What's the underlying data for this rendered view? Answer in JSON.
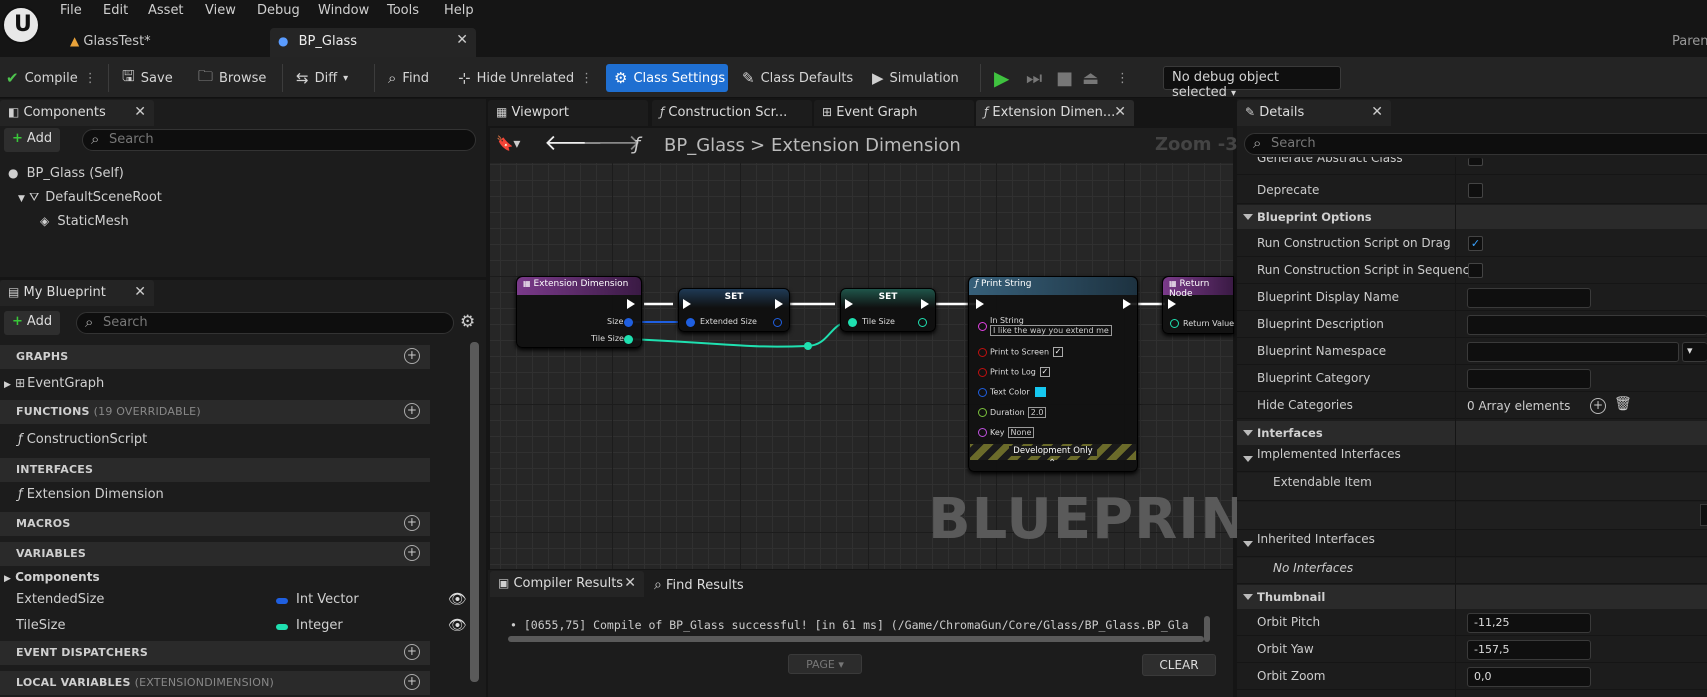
{
  "menu": [
    "File",
    "Edit",
    "Asset",
    "View",
    "Debug",
    "Window",
    "Tools",
    "Help"
  ],
  "top_right": "Paren",
  "tabs": [
    {
      "label": "GlassTest*"
    },
    {
      "label": "BP_Glass"
    }
  ],
  "toolbar": {
    "compile": "Compile",
    "save": "Save",
    "browse": "Browse",
    "diff": "Diff",
    "find": "Find",
    "hide_unrelated": "Hide Unrelated",
    "class_settings": "Class Settings",
    "class_defaults": "Class Defaults",
    "simulation": "Simulation",
    "debug_object": "No debug object selected"
  },
  "components": {
    "title": "Components",
    "add": "Add",
    "search_placeholder": "Search",
    "items": [
      "BP_Glass (Self)",
      "DefaultSceneRoot",
      "StaticMesh"
    ]
  },
  "my_blueprint": {
    "title": "My Blueprint",
    "add": "Add",
    "search_placeholder": "Search",
    "graphs": "GRAPHS",
    "event_graph": "EventGraph",
    "functions": "FUNCTIONS",
    "functions_sub": "(19 OVERRIDABLE)",
    "construction_script": "ConstructionScript",
    "interfaces": "INTERFACES",
    "extension_dimension": "Extension Dimension",
    "macros": "MACROS",
    "variables": "VARIABLES",
    "components_group": "Components",
    "vars": [
      {
        "name": "ExtendedSize",
        "type": "Int Vector",
        "color": "#1f5fe0"
      },
      {
        "name": "TileSize",
        "type": "Integer",
        "color": "#1fe0b0"
      }
    ],
    "event_dispatchers": "EVENT DISPATCHERS",
    "local_variables": "LOCAL VARIABLES",
    "local_variables_sub": "(EXTENSIONDIMENSION)"
  },
  "graph_tabs": [
    "Viewport",
    "Construction Scr...",
    "Event Graph",
    "Extension Dimen..."
  ],
  "breadcrumb": {
    "root": "BP_Glass",
    "sep": ">",
    "current": "Extension Dimension",
    "zoom": "Zoom -3"
  },
  "nodes": {
    "entry": {
      "title": "Extension Dimension",
      "pins": [
        "Size",
        "Tile Size"
      ]
    },
    "set1": {
      "title": "SET",
      "pin": "Extended Size"
    },
    "set2": {
      "title": "SET",
      "pin": "Tile Size"
    },
    "print": {
      "title": "Print String",
      "in_string": "In String",
      "in_string_value": "I like the way you extend me",
      "print_to_screen": "Print to Screen",
      "print_to_log": "Print to Log",
      "text_color": "Text Color",
      "duration": "Duration",
      "duration_value": "2.0",
      "key": "Key",
      "key_value": "None",
      "dev_only": "Development Only"
    },
    "ret": {
      "title": "Return Node",
      "pin": "Return Value"
    }
  },
  "watermark": "BLUEPRINT",
  "bottom": {
    "compiler_tab": "Compiler Results",
    "find_tab": "Find Results",
    "message": "• [0655,75] Compile of BP_Glass successful! [in 61 ms] (/Game/ChromaGun/Core/Glass/BP_Glass.BP_Gla",
    "page": "PAGE",
    "clear": "CLEAR"
  },
  "details": {
    "title": "Details",
    "search_placeholder": "Search",
    "cut_row": "Generate Abstract Class",
    "deprecate": "Deprecate",
    "bp_options": "Blueprint Options",
    "run_drag": "Run Construction Script on Drag",
    "run_seq": "Run Construction Script in Sequencer",
    "display_name": "Blueprint Display Name",
    "description": "Blueprint Description",
    "namespace": "Blueprint Namespace",
    "category": "Blueprint Category",
    "hide_categories": "Hide Categories",
    "hide_categories_value": "0 Array elements",
    "interfaces": "Interfaces",
    "implemented": "Implemented Interfaces",
    "extendable": "Extendable Item",
    "inherited": "Inherited Interfaces",
    "no_interfaces": "No Interfaces",
    "thumbnail": "Thumbnail",
    "orbit_pitch": "Orbit Pitch",
    "orbit_pitch_value": "-11,25",
    "orbit_yaw": "Orbit Yaw",
    "orbit_yaw_value": "-157,5",
    "orbit_zoom": "Orbit Zoom",
    "orbit_zoom_value": "0,0"
  }
}
